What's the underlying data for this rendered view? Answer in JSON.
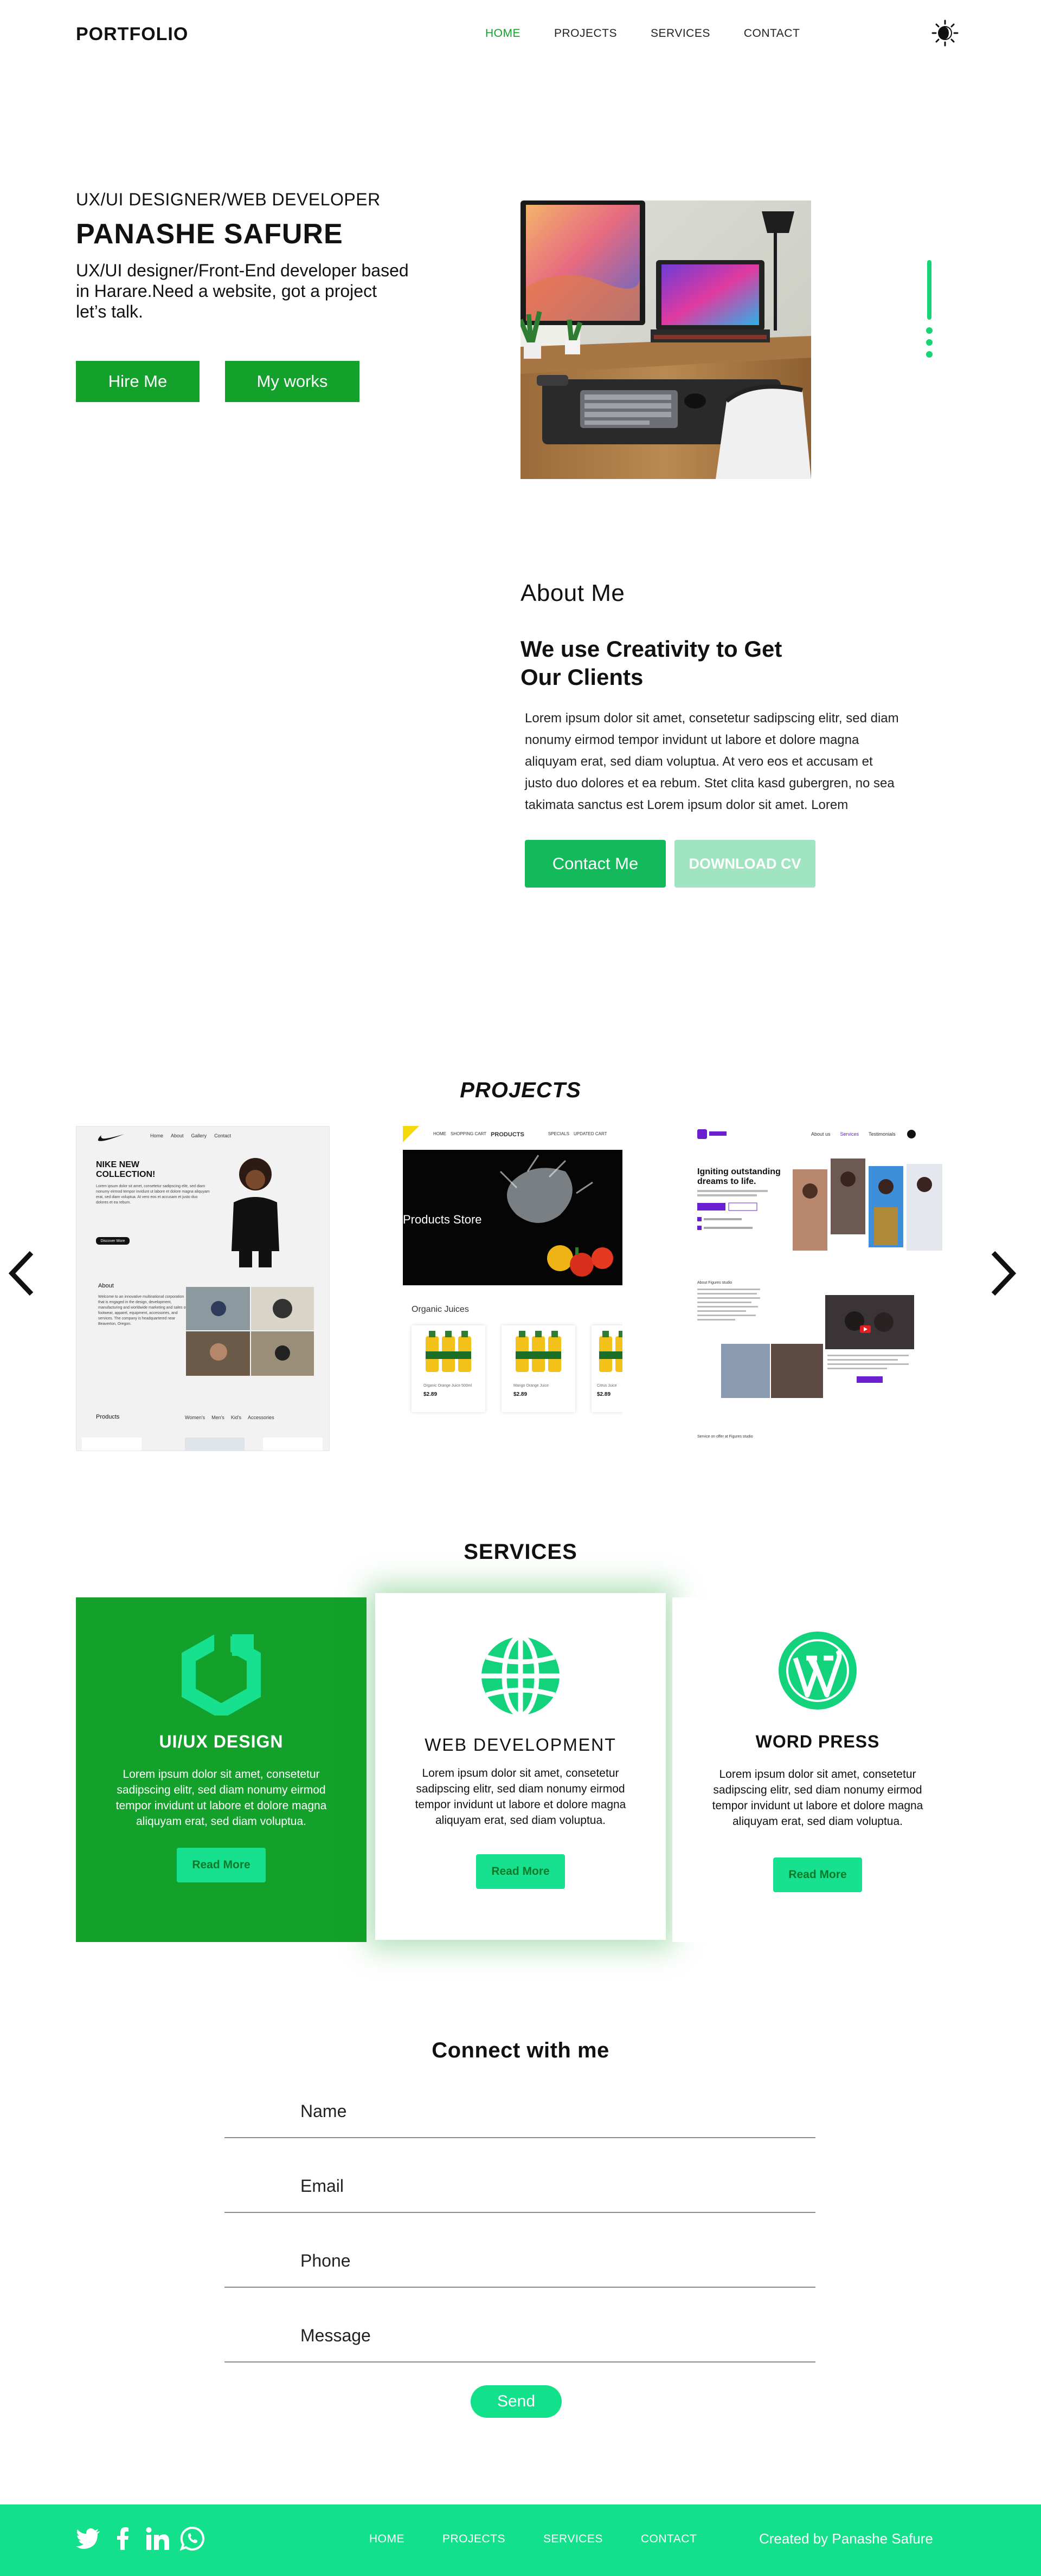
{
  "nav": {
    "brand": "PORTFOLIO",
    "links": [
      "HOME",
      "PROJECTS",
      "SERVICES",
      "CONTACT"
    ],
    "active": "HOME"
  },
  "hero": {
    "subtitle": "UX/UI DESIGNER/WEB DEVELOPER",
    "name": "PANASHE SAFURE",
    "description": "UX/UI designer/Front-End developer based in Harare.Need a  website, got a project let’s talk.",
    "hire_label": "Hire Me",
    "works_label": "My works"
  },
  "about": {
    "kicker": "About Me",
    "title": "We use Creativity to Get Our Clients",
    "body": "Lorem ipsum dolor sit amet, consetetur sadipscing elitr, sed diam nonumy eirmod tempor invidunt ut labore et dolore magna aliquyam erat, sed diam voluptua. At vero eos et accusam et justo duo dolores et ea rebum. Stet clita kasd gubergren, no sea takimata sanctus est Lorem ipsum dolor sit amet. Lorem",
    "contact_label": "Contact Me",
    "cv_label": "DOWNLOAD CV"
  },
  "projects": {
    "title": "PROJECTS",
    "p1": {
      "nav": [
        "Home",
        "About",
        "Gallery",
        "Contact"
      ],
      "headline": "NIKE NEW COLLECTION!",
      "blurb": "Lorem ipsum dolor sit amet, consetetur sadipscing elitr, sed diam nonumy eirmod tempor invidunt ut labore et dolore magna aliquyam erat, sed diam voluptua. At vero eos et accusam et justo duo dolores et ea rebum.",
      "cta": "Discover More",
      "about_label": "About",
      "about_text": "Welcome to an innovative multinational corporation that is engaged in the design, development, manufacturing and worldwide marketing and sales of footwear, apparel, equipment, accessories, and services. The company is headquartered near Beaverton, Oregon.",
      "products_label": "Products",
      "categories": [
        "Women's",
        "Men's",
        "Kid's",
        "Accessories"
      ]
    },
    "p2": {
      "nav": [
        "HOME",
        "SHOPPING CART",
        "PRODUCTS",
        "SPECIALS",
        "UPDATED CART"
      ],
      "banner": "Products Store",
      "section": "Organic Juices",
      "items": [
        {
          "name": "Organic Orange Juice 500ml",
          "price": "$2.89"
        },
        {
          "name": "Mango Orange Juice",
          "price": "$2.89"
        },
        {
          "name": "Citrus Juice",
          "price": "$2.89"
        }
      ]
    },
    "p3": {
      "nav": [
        "About us",
        "Services",
        "Testimonials"
      ],
      "headline": "Igniting outstanding dreams to life.",
      "about_label": "About Figures studio",
      "services_label": "Service on offer at Figures studio"
    }
  },
  "services": {
    "title": "SERVICES",
    "items": [
      {
        "title": "UI/UX DESIGN",
        "text": "Lorem ipsum dolor sit amet, consetetur sadipscing elitr, sed diam nonumy eirmod tempor invidunt ut labore et dolore magna aliquyam erat, sed diam voluptua.",
        "button": "Read More",
        "icon": "uiux-icon"
      },
      {
        "title": "WEB DEVELOPMENT",
        "text": "Lorem ipsum dolor sit amet, consetetur sadipscing elitr, sed diam nonumy eirmod tempor invidunt ut labore et dolore magna aliquyam erat, sed diam voluptua.",
        "button": "Read More",
        "icon": "globe-icon"
      },
      {
        "title": "WORD PRESS",
        "text": "Lorem ipsum dolor sit amet, consetetur sadipscing elitr, sed diam nonumy eirmod tempor invidunt ut labore et dolore magna aliquyam erat, sed diam voluptua.",
        "button": "Read More",
        "icon": "wordpress-icon"
      }
    ]
  },
  "contact": {
    "title": "Connect with me",
    "fields": [
      "Name",
      "Email",
      "Phone",
      "Message"
    ],
    "send_label": "Send"
  },
  "footer": {
    "social_icons": [
      "twitter-icon",
      "facebook-icon",
      "linkedin-icon",
      "whatsapp-icon"
    ],
    "links": [
      "HOME",
      "PROJECTS",
      "SERVICES",
      "CONTACT"
    ],
    "credit": "Created by Panashe Safure"
  },
  "colors": {
    "primary_green": "#13a02b",
    "accent_mint": "#13e08a",
    "contact_green": "#13b95a",
    "cv_mint": "#a0e4c2"
  }
}
